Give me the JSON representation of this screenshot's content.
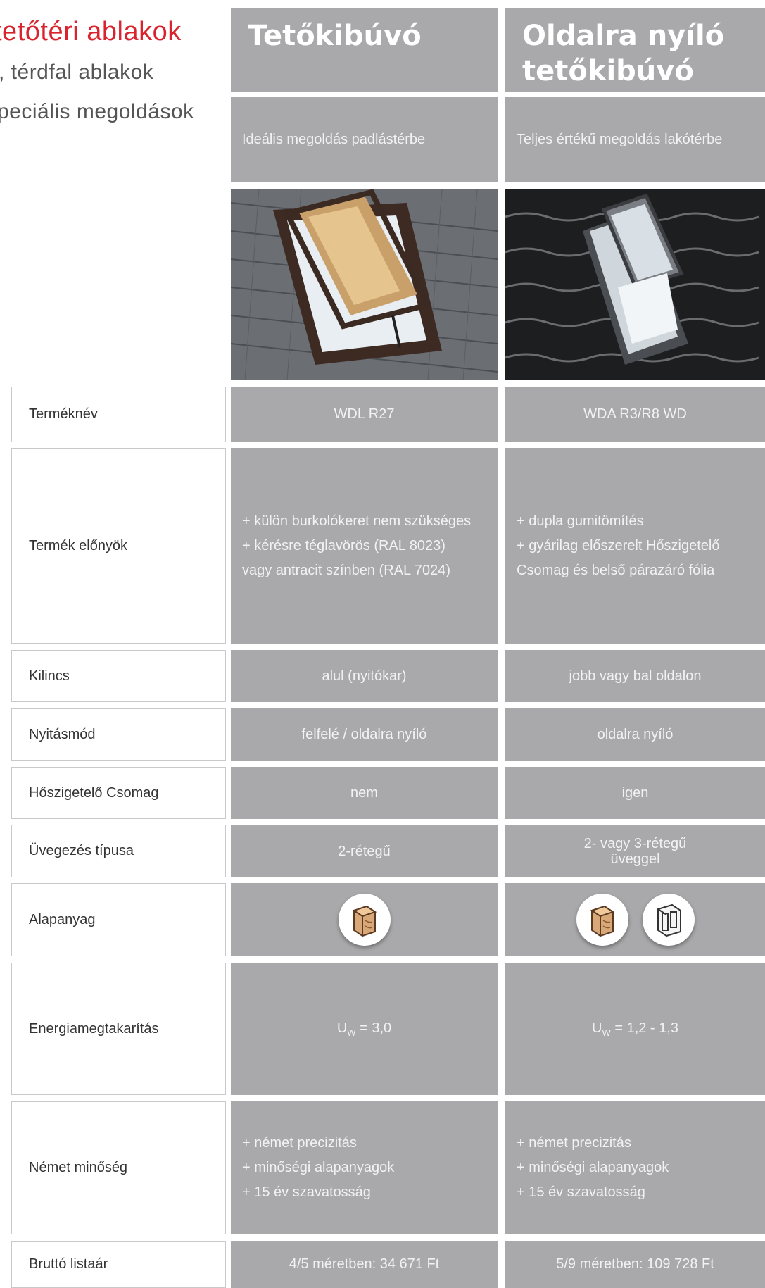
{
  "nav": {
    "item1": "tetőtéri ablakok",
    "item2": ", térdfal ablakok",
    "item3": "peciális megoldások"
  },
  "products": [
    {
      "title_line1": "Tetőkibúvó",
      "title_line2": "",
      "subtitle": "Ideális megoldás padlástérbe",
      "photo": "roof-window-wooden-frame-slate-roof",
      "name": "WDL R27",
      "benefits": [
        "+ külön burkolókeret nem szükséges",
        "+ kérésre téglavörös (RAL 8023)",
        "vagy antracit színben (RAL 7024)"
      ],
      "handle": "alul (nyitókar)",
      "opening": "felfelé / oldalra nyíló",
      "insulation": "nem",
      "glazing_line1": "2-rétegű",
      "glazing_line2": "",
      "materials": [
        "wood-icon"
      ],
      "energy_prefix": "U",
      "energy_sub": "W",
      "energy_value": " = 3,0",
      "quality": [
        "+ német precizitás",
        "+ minőségi alapanyagok",
        "+ 15 év szavatosság"
      ],
      "price": "4/5 méretben: 34 671 Ft"
    },
    {
      "title_line1": "Oldalra nyíló",
      "title_line2": "tetőkibúvó",
      "subtitle": "Teljes értékű megoldás lakótérbe",
      "photo": "roof-window-grey-frame-dark-tiles",
      "name": "WDA R3/R8 WD",
      "benefits": [
        "+ dupla gumitömítés",
        "+ gyárilag előszerelt Hőszigetelő",
        "Csomag és belső párazáró fólia"
      ],
      "handle": "jobb vagy bal oldalon",
      "opening": "oldalra nyíló",
      "insulation": "igen",
      "glazing_line1": "2- vagy 3-rétegű",
      "glazing_line2": "üveggel",
      "materials": [
        "wood-icon",
        "plastic-profile-icon"
      ],
      "energy_prefix": "U",
      "energy_sub": "W",
      "energy_value": " = 1,2 - 1,3",
      "quality": [
        "+ német precizitás",
        "+ minőségi alapanyagok",
        "+ 15 év szavatosság"
      ],
      "price": "5/9 méretben: 109 728 Ft"
    }
  ],
  "row_labels": {
    "name": "Terméknév",
    "benefits": "Termék előnyök",
    "handle": "Kilincs",
    "opening": "Nyitásmód",
    "insulation": "Hőszigetelő Csomag",
    "glazing": "Üvegezés típusa",
    "material": "Alapanyag",
    "energy": "Energiamegtakarítás",
    "quality": "Német minőség",
    "price": "Bruttó listaár"
  },
  "colors": {
    "accent": "#d9232d",
    "cell": "#a9a9ab",
    "cell_text": "#f2f2f2"
  }
}
